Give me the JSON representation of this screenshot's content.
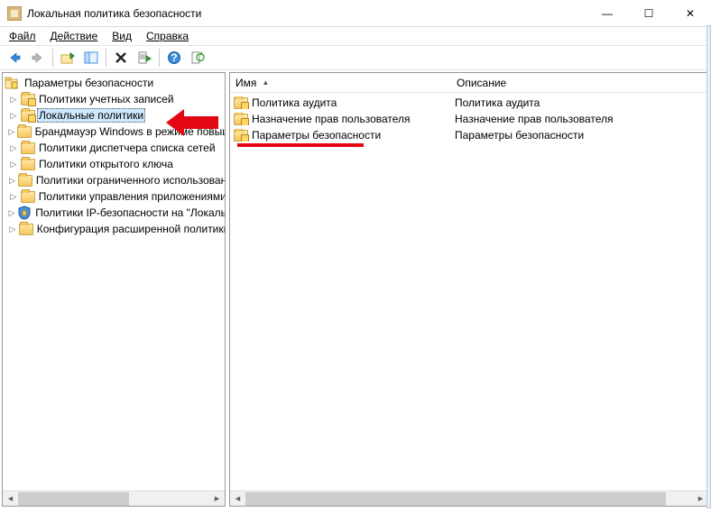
{
  "window": {
    "title": "Локальная политика безопасности",
    "buttons": {
      "minimize": "—",
      "maximize": "☐",
      "close": "✕"
    }
  },
  "menu": {
    "file": "Файл",
    "action": "Действие",
    "view": "Вид",
    "help": "Справка"
  },
  "tree": {
    "root": "Параметры безопасности",
    "items": [
      {
        "label": "Политики учетных записей",
        "icon": "folder-lock"
      },
      {
        "label": "Локальные политики",
        "icon": "folder-lock",
        "selected": true
      },
      {
        "label": "Брандмауэр Windows в режиме повышенной безопасности",
        "icon": "folder"
      },
      {
        "label": "Политики диспетчера списка сетей",
        "icon": "folder"
      },
      {
        "label": "Политики открытого ключа",
        "icon": "folder"
      },
      {
        "label": "Политики ограниченного использования программ",
        "icon": "folder"
      },
      {
        "label": "Политики управления приложениями",
        "icon": "folder"
      },
      {
        "label": "Политики IP-безопасности на \"Локальный компьютер\"",
        "icon": "shield"
      },
      {
        "label": "Конфигурация расширенной политики аудита",
        "icon": "folder"
      }
    ]
  },
  "list": {
    "columns": {
      "name": "Имя",
      "description": "Описание"
    },
    "rows": [
      {
        "name": "Политика аудита",
        "description": "Политика аудита"
      },
      {
        "name": "Назначение прав пользователя",
        "description": "Назначение прав пользователя"
      },
      {
        "name": "Параметры безопасности",
        "description": "Параметры безопасности"
      }
    ]
  }
}
